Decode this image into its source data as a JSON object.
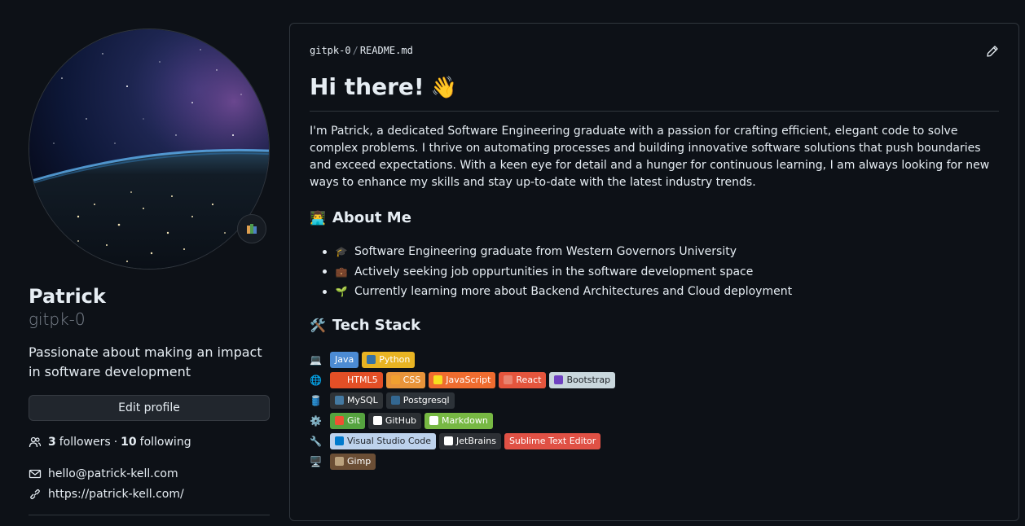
{
  "profile": {
    "fullname": "Patrick",
    "username": "gitpk-0",
    "bio": "Passionate about making an impact in software development",
    "edit_label": "Edit profile",
    "followers_count": "3",
    "followers_label": "followers",
    "dot": "·",
    "following_count": "10",
    "following_label": "following",
    "email": "hello@patrick-kell.com",
    "website": "https://patrick-kell.com/"
  },
  "readme": {
    "repo": "gitpk-0",
    "separator": "/",
    "file": "README.md",
    "heading": "Hi there!",
    "wave_emoji": "👋",
    "intro": "I'm Patrick, a dedicated Software Engineering graduate with a passion for crafting efficient, elegant code to solve complex problems. I thrive on automating processes and building innovative software solutions that push boundaries and exceed expectations. With a keen eye for detail and a hunger for continuous learning, I am always looking for new ways to enhance my skills and stay up-to-date with the latest industry trends.",
    "about_heading": "About Me",
    "about_emoji": "👨‍💻",
    "about_items": [
      {
        "emoji": "🎓",
        "text": "Software Engineering graduate from Western Governors University"
      },
      {
        "emoji": "💼",
        "text": "Actively seeking job oppurtunities in the software development space"
      },
      {
        "emoji": "🌱",
        "text": "Currently learning more about Backend Architectures and Cloud deployment"
      }
    ],
    "stack_heading": "Tech Stack",
    "stack_emoji": "🛠️",
    "stack_rows": [
      {
        "emoji": "💻",
        "badges": [
          {
            "label": "Java",
            "bg": "#4c8bd4",
            "logo": ""
          },
          {
            "label": "Python",
            "bg": "#e8b423",
            "logo": "#3572a5"
          }
        ]
      },
      {
        "emoji": "🌐",
        "badges": [
          {
            "label": "HTML5",
            "bg": "#e34f26",
            "logo": "#e34f26"
          },
          {
            "label": "CSS",
            "bg": "#e8943a",
            "logo": "#f0a030"
          },
          {
            "label": "JavaScript",
            "bg": "#ef6c2f",
            "logo": "#f7df1e"
          },
          {
            "label": "React",
            "bg": "#e4553d",
            "logo": "#e9836f"
          },
          {
            "label": "Bootstrap",
            "bg": "#c9d7dd",
            "logo": "#6f42c1"
          }
        ]
      },
      {
        "emoji": "🛢️",
        "badges": [
          {
            "label": "MySQL",
            "bg": "#2f3337",
            "logo": "#4479a1"
          },
          {
            "label": "Postgresql",
            "bg": "#2c3238",
            "logo": "#336791"
          }
        ]
      },
      {
        "emoji": "⚙️",
        "badges": [
          {
            "label": "Git",
            "bg": "#55a33f",
            "logo": "#f05032"
          },
          {
            "label": "GitHub",
            "bg": "#2b2f33",
            "logo": "#ffffff"
          },
          {
            "label": "Markdown",
            "bg": "#77b843",
            "logo": "#ffffff"
          }
        ]
      },
      {
        "emoji": "🔧",
        "badges": [
          {
            "label": "Visual Studio Code",
            "bg": "#bdd2ec",
            "logo": "#007acc"
          },
          {
            "label": "JetBrains",
            "bg": "#2d3035",
            "logo": "#ffffff"
          },
          {
            "label": "Sublime Text Editor",
            "bg": "#e05145",
            "logo": ""
          }
        ]
      },
      {
        "emoji": "🖥️",
        "badges": [
          {
            "label": "Gimp",
            "bg": "#6b4e35",
            "logo": "#bba27e"
          }
        ]
      }
    ]
  },
  "colors": {
    "background": "#0d1117",
    "border": "#30363d",
    "text": "#e6edf3",
    "muted": "#7d8590"
  }
}
